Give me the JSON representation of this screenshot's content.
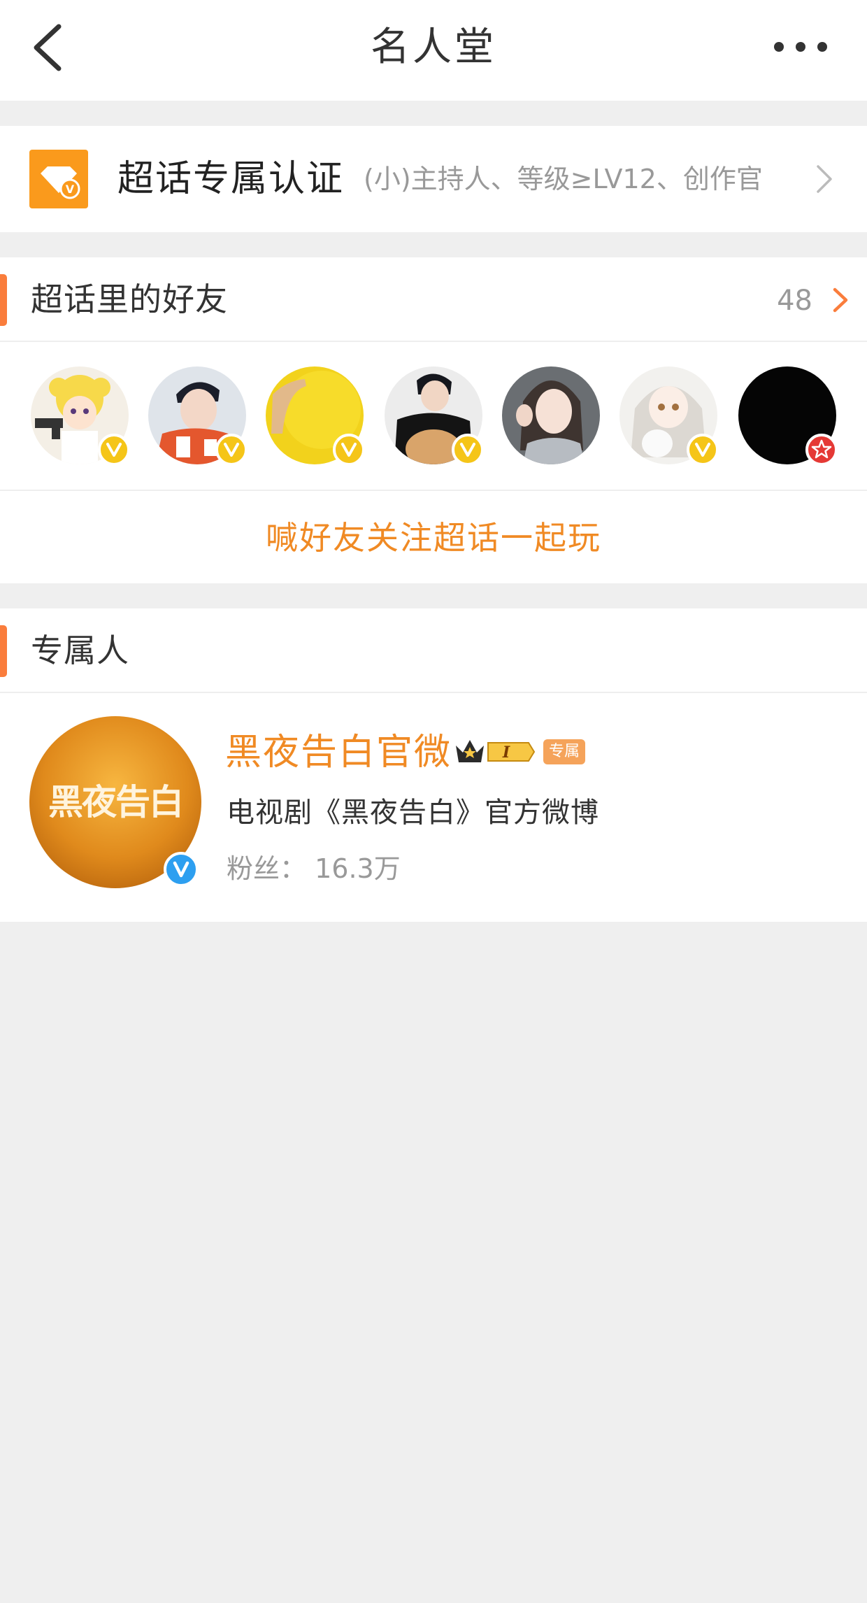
{
  "header": {
    "title": "名人堂"
  },
  "certification": {
    "title": "超话专属认证",
    "subtitle": "(小)主持人、等级≥LV12、创作官"
  },
  "friends": {
    "section_title": "超话里的好友",
    "count": "48",
    "avatars": [
      {
        "icon": "cartoon-girl-avatar",
        "badge": "verified-yellow"
      },
      {
        "icon": "man-portrait-avatar",
        "badge": "verified-yellow"
      },
      {
        "icon": "yellow-ball-avatar",
        "badge": "verified-yellow"
      },
      {
        "icon": "man-with-dog-avatar",
        "badge": "verified-yellow"
      },
      {
        "icon": "woman-selfie-avatar",
        "badge": "verified-yellow"
      },
      {
        "icon": "anime-girl-cat-avatar",
        "badge": "verified-yellow"
      },
      {
        "icon": "black-avatar",
        "badge": "red-star"
      }
    ],
    "invite_label": "喊好友关注超话一起玩"
  },
  "exclusive": {
    "section_title": "专属人",
    "user": {
      "avatar_text": "黑夜告白",
      "name": "黑夜告白官微",
      "level_badge": "I",
      "tag": "专属",
      "description": "电视剧《黑夜告白》官方微博",
      "fans_label": "粉丝：",
      "fans_value": "16.3万"
    }
  },
  "colors": {
    "accent_orange": "#fa7d3c",
    "link_orange": "#f08a24",
    "verified_yellow": "#f5c518",
    "verified_blue": "#2d9ff0",
    "badge_red": "#e53935"
  }
}
